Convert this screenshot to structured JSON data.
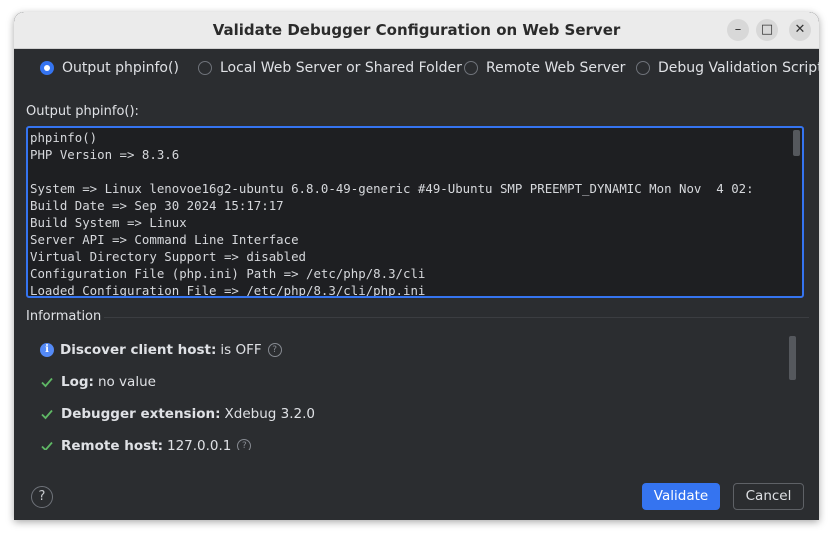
{
  "window": {
    "title": "Validate Debugger Configuration on Web Server",
    "minimize": "–",
    "maximize": "□",
    "close": "✕"
  },
  "options": [
    {
      "label": "Output phpinfo()",
      "selected": true
    },
    {
      "label": "Local Web Server or Shared Folder",
      "selected": false
    },
    {
      "label": "Remote Web Server",
      "selected": false
    },
    {
      "label": "Debug Validation Script",
      "selected": false
    }
  ],
  "output": {
    "label": "Output phpinfo():",
    "text": "phpinfo()\nPHP Version => 8.3.6\n\nSystem => Linux lenovoe16g2-ubuntu 6.8.0-49-generic #49-Ubuntu SMP PREEMPT_DYNAMIC Mon Nov  4 02:\nBuild Date => Sep 30 2024 15:17:17\nBuild System => Linux\nServer API => Command Line Interface\nVirtual Directory Support => disabled\nConfiguration File (php.ini) Path => /etc/php/8.3/cli\nLoaded Configuration File => /etc/php/8.3/cli/php.ini"
  },
  "information": {
    "label": "Information",
    "items": [
      {
        "icon": "info-icon",
        "key": "Discover client host:",
        "value": "is OFF",
        "help": true
      },
      {
        "icon": "check-icon",
        "key": "Log:",
        "value": "no value",
        "help": false
      },
      {
        "icon": "check-icon",
        "key": "Debugger extension:",
        "value": "Xdebug 3.2.0",
        "help": false
      },
      {
        "icon": "check-icon",
        "key": "Remote host:",
        "value": "127.0.0.1",
        "help": true
      }
    ]
  },
  "buttons": {
    "help": "?",
    "validate": "Validate",
    "cancel": "Cancel"
  },
  "colors": {
    "accent": "#3574f0",
    "check": "#5fb865",
    "background": "#2b2d30"
  }
}
